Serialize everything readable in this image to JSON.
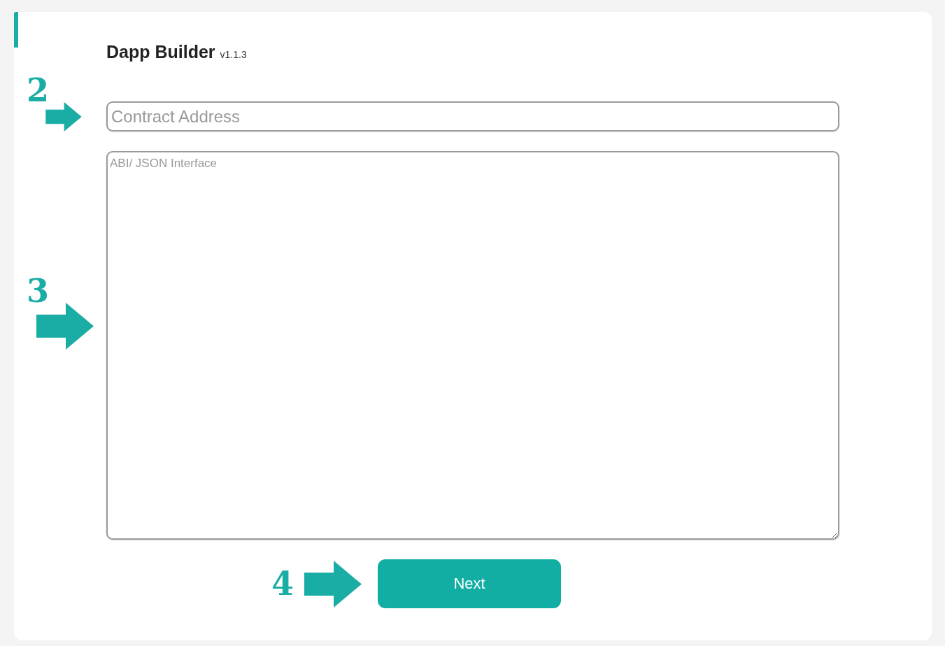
{
  "title": "Dapp Builder",
  "version": "v1.1.3",
  "contract_field": {
    "placeholder": "Contract Address",
    "step": "2"
  },
  "abi_field": {
    "placeholder": "ABI/ JSON Interface",
    "step": "3"
  },
  "next_button": {
    "label": "Next",
    "step": "4"
  }
}
